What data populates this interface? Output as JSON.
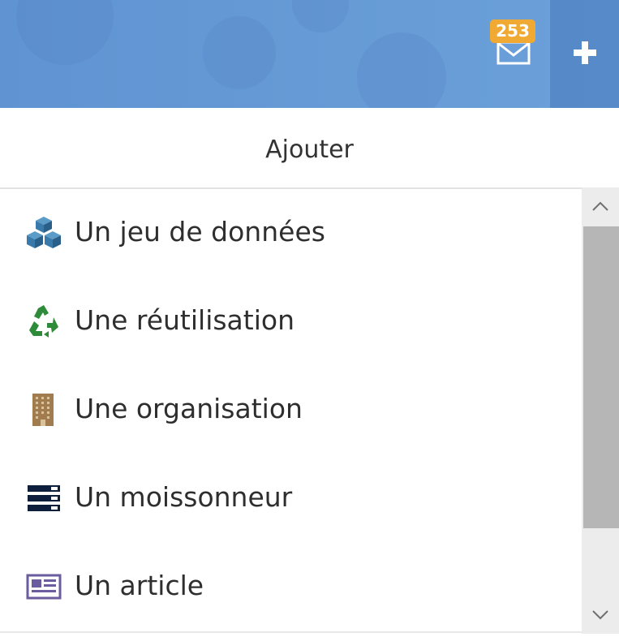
{
  "header": {
    "background_color": "#669bd6",
    "mail": {
      "icon": "mail-icon",
      "unread_count": "253",
      "badge_color": "#f0a932"
    },
    "add_button": {
      "icon": "plus-icon"
    }
  },
  "menu": {
    "title": "Ajouter",
    "items": [
      {
        "label": "Un jeu de données",
        "icon": "dataset-cubes-icon",
        "icon_color": "#2f6f9f"
      },
      {
        "label": "Une réutilisation",
        "icon": "recycle-icon",
        "icon_color": "#2e8b3a"
      },
      {
        "label": "Une organisation",
        "icon": "building-icon",
        "icon_color": "#a07c4e"
      },
      {
        "label": "Un moissonneur",
        "icon": "server-icon",
        "icon_color": "#0d1f3c"
      },
      {
        "label": "Un article",
        "icon": "newspaper-icon",
        "icon_color": "#6a5c9e"
      }
    ]
  },
  "scrollbar": {
    "up_icon": "chevron-up-icon",
    "down_icon": "chevron-down-icon"
  }
}
